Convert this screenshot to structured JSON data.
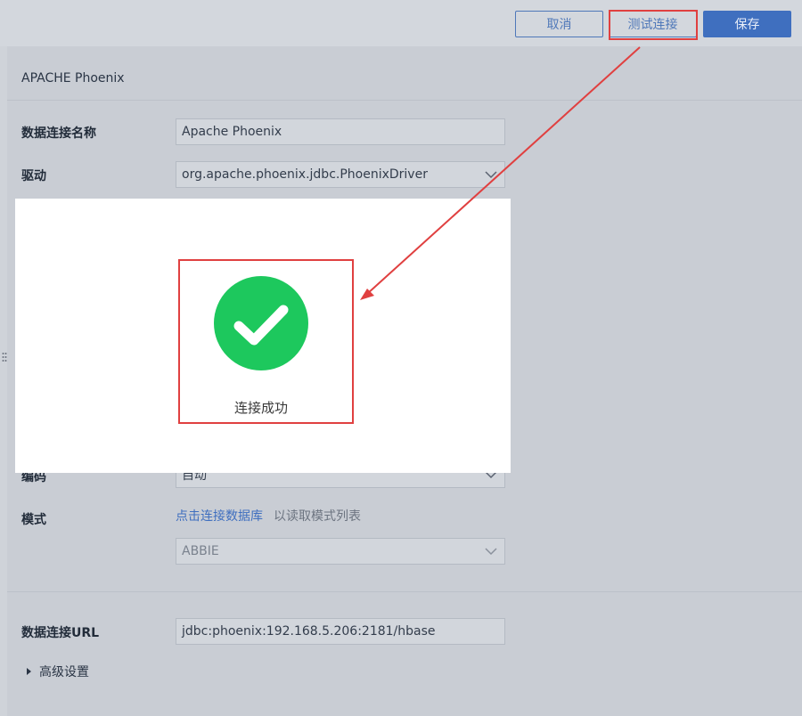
{
  "toolbar": {
    "cancel_label": "取消",
    "test_label": "测试连接",
    "save_label": "保存"
  },
  "panel": {
    "title": "APACHE Phoenix",
    "fields": {
      "connection_name_label": "数据连接名称",
      "connection_name_value": "Apache Phoenix",
      "driver_label": "驱动",
      "driver_value": "org.apache.phoenix.jdbc.PhoenixDriver",
      "encoding_label": "编码",
      "encoding_value": "自动",
      "schema_label": "模式",
      "schema_link": "点击连接数据库",
      "schema_hint": "以读取模式列表",
      "schema_value": "ABBIE",
      "url_label": "数据连接URL",
      "url_value": "jdbc:phoenix:192.168.5.206:2181/hbase"
    },
    "advanced_label": "高级设置"
  },
  "dialog": {
    "message": "连接成功",
    "icon": "check-circle-icon"
  },
  "colors": {
    "accent": "#3f6fbf",
    "success": "#1dc85d",
    "annotation": "#e04040"
  }
}
